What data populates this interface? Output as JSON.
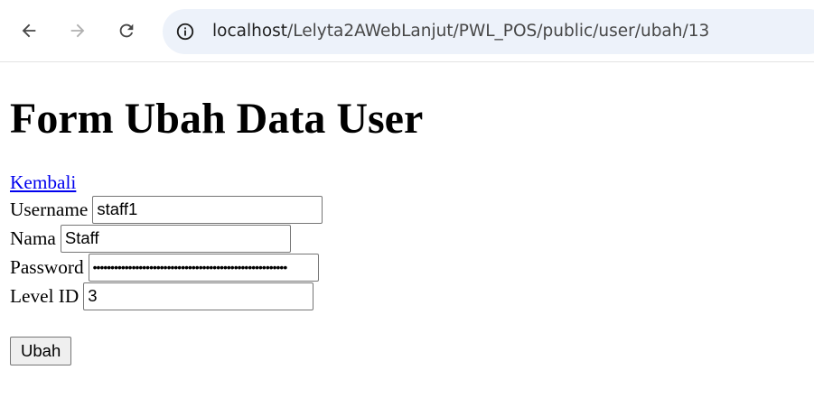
{
  "browser": {
    "url_host": "localhost",
    "url_path": "/Lelyta2AWebLanjut/PWL_POS/public/user/ubah/13"
  },
  "page": {
    "title": "Form Ubah Data User",
    "back_link": "Kembali"
  },
  "form": {
    "username": {
      "label": "Username",
      "value": "staff1"
    },
    "nama": {
      "label": "Nama",
      "value": "Staff"
    },
    "password": {
      "label": "Password",
      "value": "$2y$12$abcdefghijklmnopqrstuvwxyz0123456789ABCDEFGHIJKL"
    },
    "level_id": {
      "label": "Level ID",
      "value": "3"
    },
    "submit_label": "Ubah"
  }
}
